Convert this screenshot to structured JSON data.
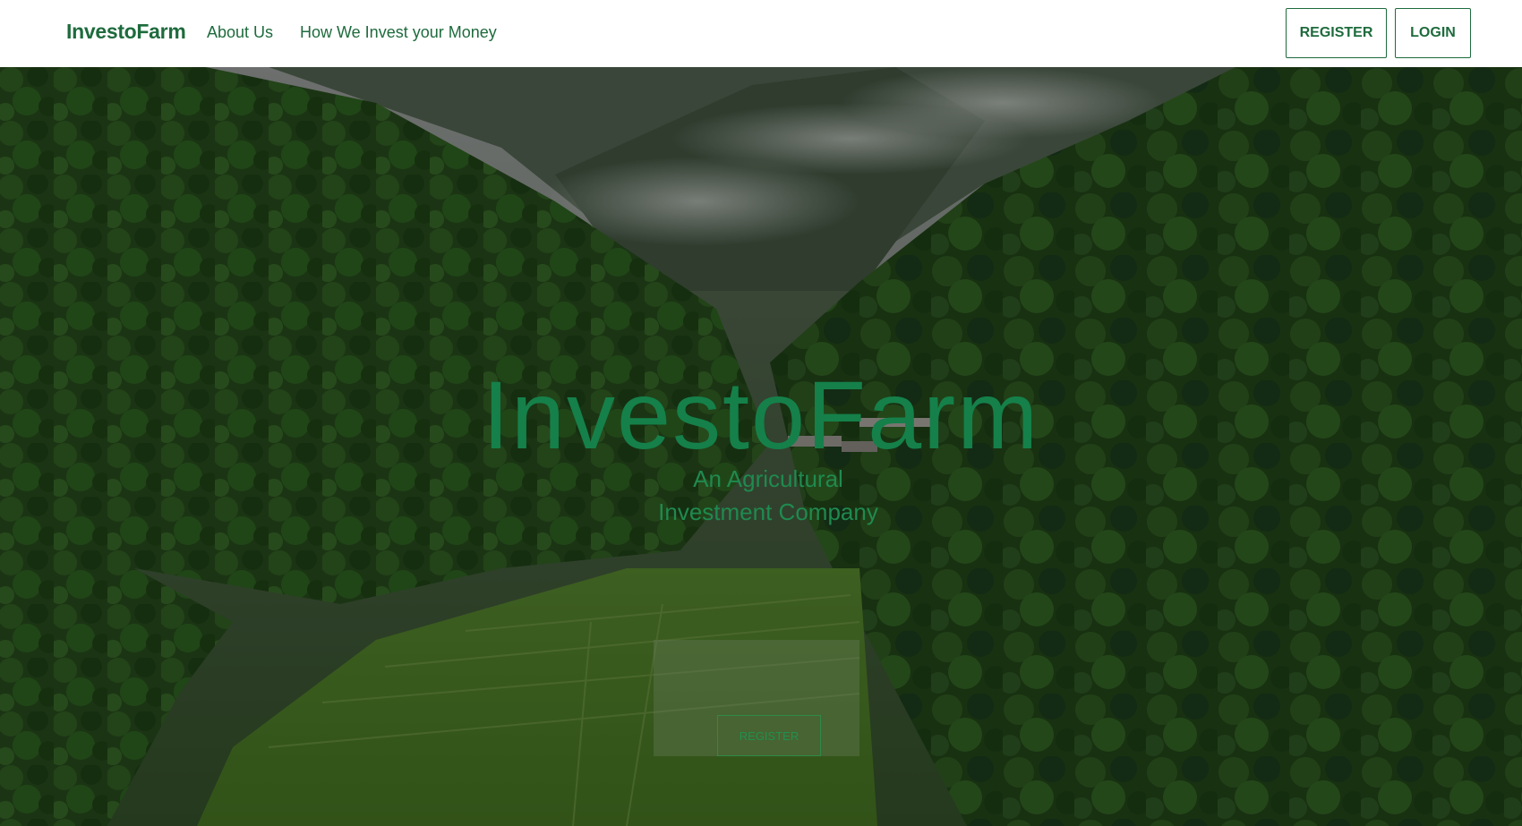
{
  "navbar": {
    "brand": "InvestoFarm",
    "links": [
      {
        "label": "About Us"
      },
      {
        "label": "How We Invest your Money"
      }
    ],
    "register_label": "REGISTER",
    "login_label": "LOGIN"
  },
  "hero": {
    "title": "InvestoFarm",
    "subtitle": "An Agricultural Investment Company",
    "register_label": "REGISTER",
    "background": "forest-valley-rice-terraces-image"
  },
  "colors": {
    "brand_green": "#1e6b3d",
    "hero_text_green": "#15804a",
    "navbar_bg": "#ffffff"
  }
}
